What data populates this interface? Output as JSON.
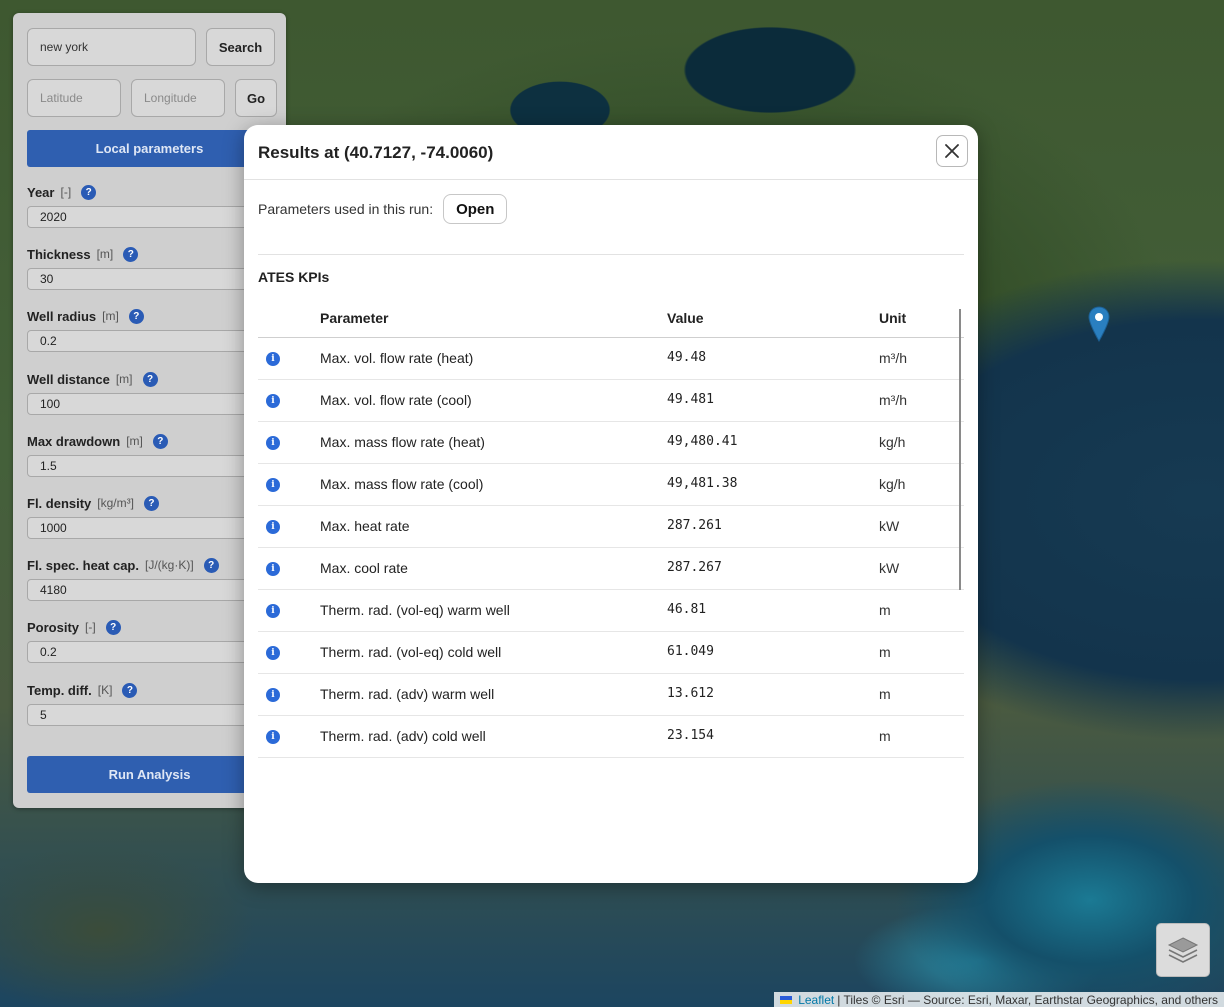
{
  "search": {
    "value": "new york",
    "button": "Search"
  },
  "coords": {
    "lat_placeholder": "Latitude",
    "lon_placeholder": "Longitude",
    "go_button": "Go"
  },
  "panel": {
    "local_params_button": "Local parameters",
    "fields": [
      {
        "label": "Year",
        "unit": "[-]",
        "value": "2020"
      },
      {
        "label": "Thickness",
        "unit": "[m]",
        "value": "30"
      },
      {
        "label": "Well radius",
        "unit": "[m]",
        "value": "0.2"
      },
      {
        "label": "Well distance",
        "unit": "[m]",
        "value": "100"
      },
      {
        "label": "Max drawdown",
        "unit": "[m]",
        "value": "1.5"
      },
      {
        "label": "Fl. density",
        "unit": "[kg/m³]",
        "value": "1000"
      },
      {
        "label": "Fl. spec. heat cap.",
        "unit": "[J/(kg·K)]",
        "value": "4180"
      },
      {
        "label": "Porosity",
        "unit": "[-]",
        "value": "0.2"
      },
      {
        "label": "Temp. diff.",
        "unit": "[K]",
        "value": "5"
      }
    ],
    "help_glyph": "?",
    "run_button": "Run Analysis"
  },
  "modal": {
    "title": "Results at (40.7127, -74.0060)",
    "params_label": "Parameters used in this run:",
    "open_button": "Open",
    "section_title": "ATES KPIs",
    "columns": {
      "parameter": "Parameter",
      "value": "Value",
      "unit": "Unit"
    },
    "info_glyph": "i",
    "rows": [
      {
        "parameter": "Max. vol. flow rate (heat)",
        "value": "49.48",
        "unit": "m³/h"
      },
      {
        "parameter": "Max. vol. flow rate (cool)",
        "value": "49.481",
        "unit": "m³/h"
      },
      {
        "parameter": "Max. mass flow rate (heat)",
        "value": "49,480.41",
        "unit": "kg/h"
      },
      {
        "parameter": "Max. mass flow rate (cool)",
        "value": "49,481.38",
        "unit": "kg/h"
      },
      {
        "parameter": "Max. heat rate",
        "value": "287.261",
        "unit": "kW"
      },
      {
        "parameter": "Max. cool rate",
        "value": "287.267",
        "unit": "kW"
      },
      {
        "parameter": "Therm. rad. (vol-eq) warm well",
        "value": "46.81",
        "unit": "m"
      },
      {
        "parameter": "Therm. rad. (vol-eq) cold well",
        "value": "61.049",
        "unit": "m"
      },
      {
        "parameter": "Therm. rad. (adv) warm well",
        "value": "13.612",
        "unit": "m"
      },
      {
        "parameter": "Therm. rad. (adv) cold well",
        "value": "23.154",
        "unit": "m"
      }
    ]
  },
  "attribution": {
    "leaflet": "Leaflet",
    "text": "| Tiles © Esri — Source: Esri, Maxar, Earthstar Geographics, and others"
  },
  "icons": {
    "marker": "map-marker-icon",
    "close": "close-icon",
    "layers": "layers-icon"
  },
  "colors": {
    "primary_button": "#2f5fb0",
    "help_icon": "#2a5bb5",
    "info_icon": "#2b6ad8",
    "marker": "#2a7fc0"
  }
}
